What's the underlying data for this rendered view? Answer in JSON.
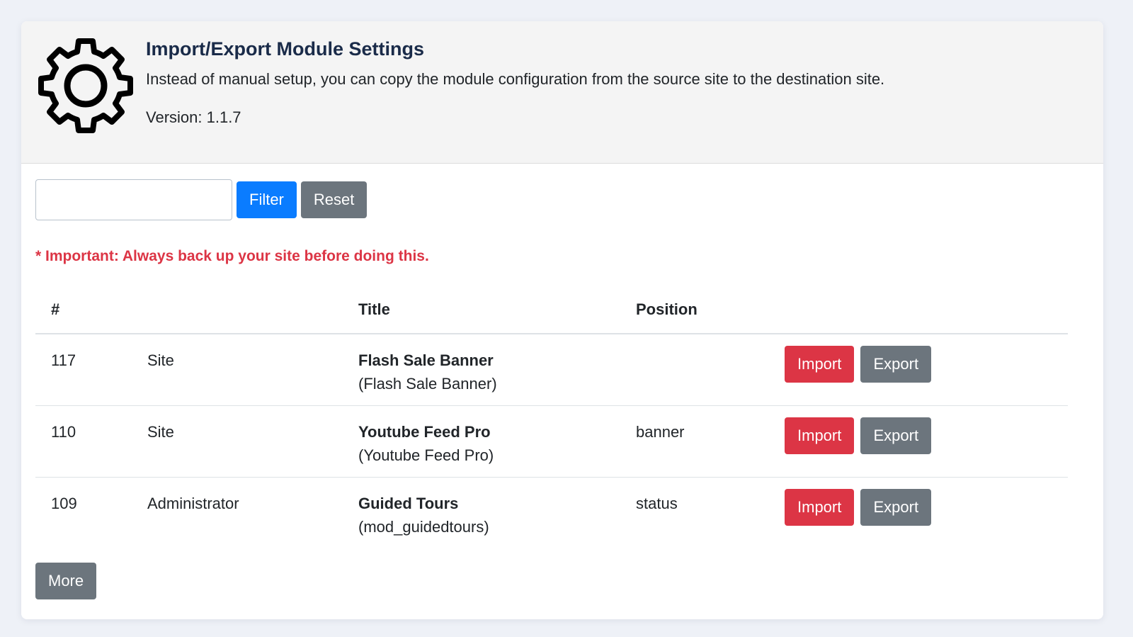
{
  "header": {
    "title": "Import/Export Module Settings",
    "description": "Instead of manual setup, you can copy the module configuration from the source site to the destination site.",
    "version": "Version: 1.1.7",
    "icon": "gear-icon"
  },
  "filter": {
    "input_value": "",
    "filter_label": "Filter",
    "reset_label": "Reset"
  },
  "warning": "* Important: Always back up your site before doing this.",
  "table": {
    "headers": [
      "#",
      "",
      "Title",
      "Position",
      ""
    ],
    "rows": [
      {
        "id": "117",
        "client": "Site",
        "title": "Flash Sale Banner",
        "subtitle": "(Flash Sale Banner)",
        "position": "",
        "import_label": "Import",
        "export_label": "Export"
      },
      {
        "id": "110",
        "client": "Site",
        "title": "Youtube Feed Pro",
        "subtitle": "(Youtube Feed Pro)",
        "position": "banner",
        "import_label": "Import",
        "export_label": "Export"
      },
      {
        "id": "109",
        "client": "Administrator",
        "title": "Guided Tours",
        "subtitle": "(mod_guidedtours)",
        "position": "status",
        "import_label": "Import",
        "export_label": "Export"
      }
    ]
  },
  "more_label": "More",
  "colors": {
    "primary": "#0a7cff",
    "secondary": "#6c757d",
    "danger": "#dc3545",
    "title": "#1a2b49"
  }
}
